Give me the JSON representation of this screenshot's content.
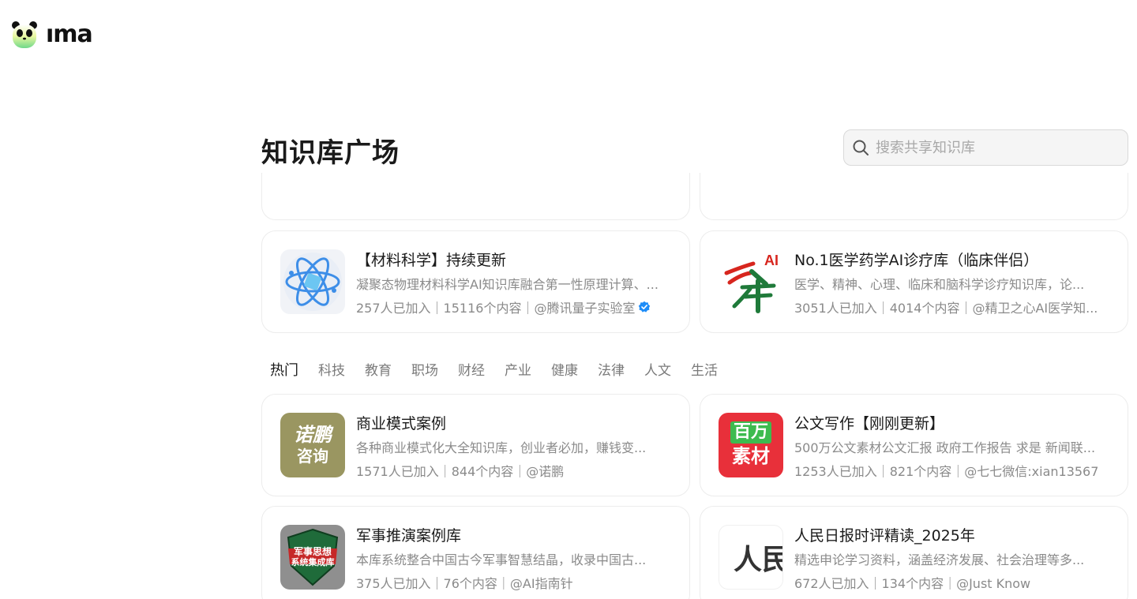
{
  "app": {
    "logo_text": "ıma"
  },
  "page": {
    "title": "知识库广场"
  },
  "search": {
    "placeholder": "搜索共享知识库"
  },
  "featured": [
    {
      "name": "【材料科学】持续更新",
      "desc": "凝聚态物理材料科学AI知识库融合第一性原理计算、...",
      "meta": "257人已加入｜15116个内容｜@腾讯量子实验室",
      "verified": true,
      "icon": "atom-icon"
    },
    {
      "name": "No.1医学药学AI诊疗库（临床伴侣）",
      "desc": "医学、精神、心理、临床和脑科学诊疗知识库，论...",
      "meta": "3051人已加入｜4014个内容｜@精卫之心AI医学知...",
      "verified": false,
      "icon": "medical-ai-logo",
      "logo_text": "AI"
    }
  ],
  "tabs": [
    "热门",
    "科技",
    "教育",
    "职场",
    "财经",
    "产业",
    "健康",
    "法律",
    "人文",
    "生活"
  ],
  "cards": [
    {
      "name": "商业模式案例",
      "desc": "各种商业模式化大全知识库，创业者必加，赚钱变...",
      "meta": "1571人已加入｜844个内容｜@诺鹏",
      "icon": "nuopeng-logo",
      "logo_line1": "诺鹏",
      "logo_line2": "咨询"
    },
    {
      "name": "公文写作【刚刚更新】",
      "desc": "500万公文素材公文汇报 政府工作报告 求是 新闻联...",
      "meta": "1253人已加入｜821个内容｜@七七微信:xian13567",
      "icon": "million-materials-logo",
      "logo_line1": "百万",
      "logo_line2": "素材"
    },
    {
      "name": "军事推演案例库",
      "desc": "本库系统整合中国古今军事智慧结晶，收录中国古...",
      "meta": "375人已加入｜76个内容｜@AI指南针",
      "icon": "military-shield-logo",
      "logo_line1": "军事思想",
      "logo_line2": "系统集成库"
    },
    {
      "name": "人民日报时评精读_2025年",
      "desc": "精选申论学习资料，涵盖经济发展、社会治理等多...",
      "meta": "672人已加入｜134个内容｜@Just Know",
      "icon": "peoples-daily-logo",
      "logo_line1": "人民"
    }
  ],
  "colors": {
    "accent_verified": "#1d8cf8",
    "nuopeng_bg": "#9a9661",
    "million_bg": "#e8303a",
    "million_inner": "#3dbb4f"
  }
}
